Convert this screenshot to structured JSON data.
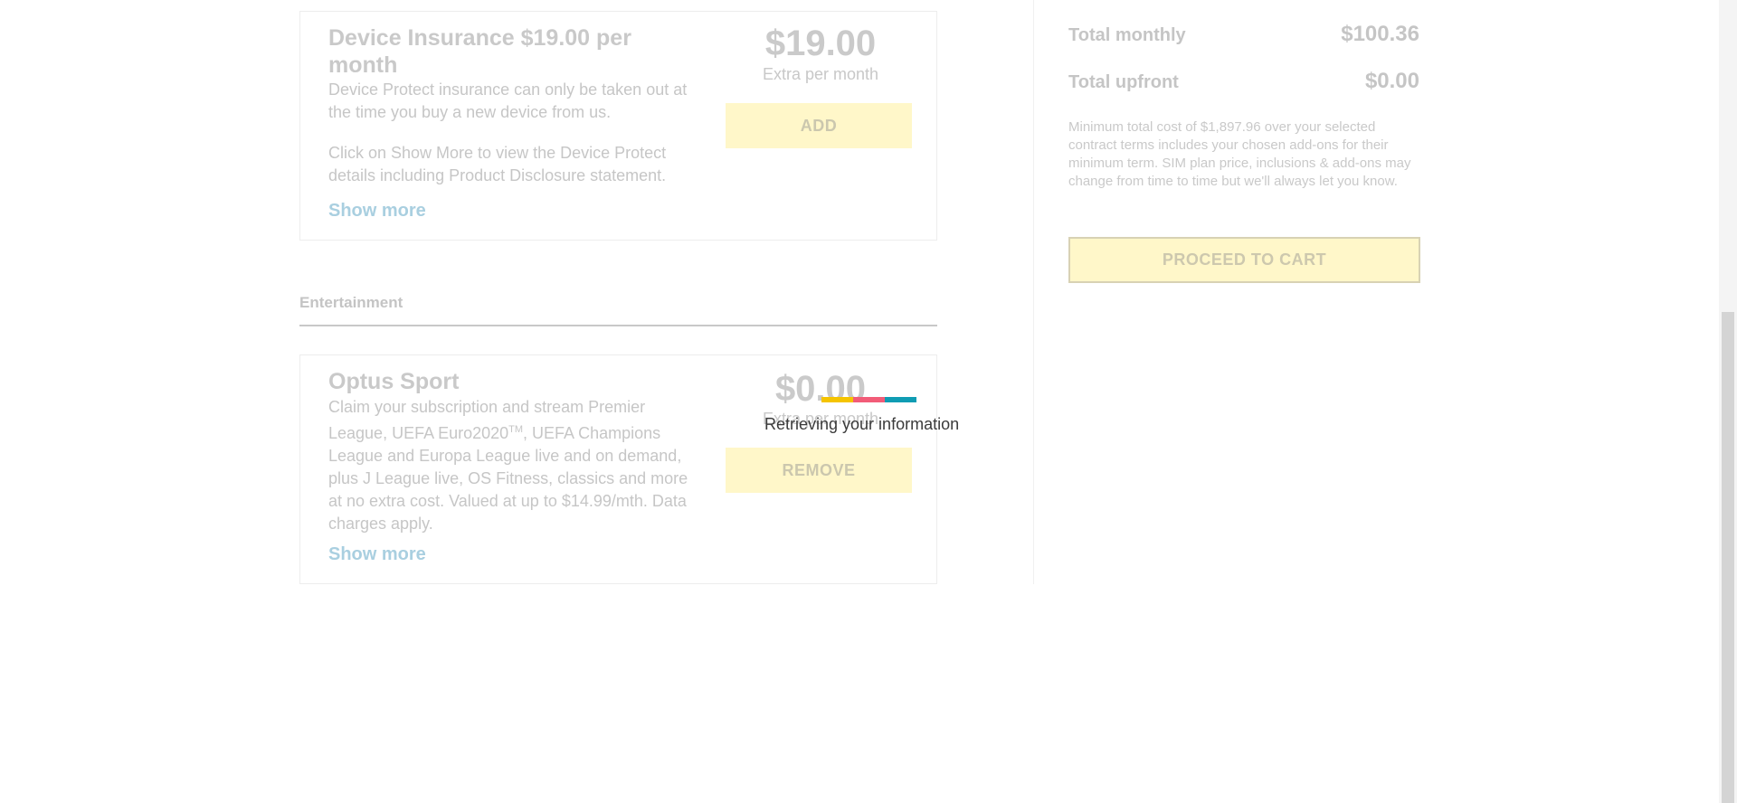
{
  "cards": {
    "device_insurance": {
      "title": "Device Insurance $19.00 per month",
      "desc1": "Device Protect insurance can only be taken out at the time you buy a new device from us.",
      "desc2": "Click on Show More to view the Device Protect details including Product Disclosure statement.",
      "show_more": "Show more",
      "price": "$19.00",
      "price_sub": "Extra per month",
      "button": "ADD"
    },
    "optus_sport": {
      "title": "Optus Sport",
      "desc_part1": "Claim your subscription and stream Premier League, UEFA Euro2020",
      "desc_sup": "TM",
      "desc_part2": ", UEFA Champions League and Europa League live and on demand, plus J League live, OS Fitness, classics and more at no extra cost. Valued at up to $14.99/mth. Data charges apply.",
      "show_more": "Show more",
      "price": "$0.00",
      "price_sub": "Extra per month",
      "button": "REMOVE"
    }
  },
  "section": {
    "entertainment": "Entertainment"
  },
  "summary": {
    "total_monthly_label": "Total monthly",
    "total_monthly_value": "$100.36",
    "total_upfront_label": "Total upfront",
    "total_upfront_value": "$0.00",
    "note": "Minimum total cost of $1,897.96 over your selected contract terms includes your chosen add-ons for their minimum term. SIM plan price, inclusions & add-ons may change from time to time but we'll always let you know.",
    "proceed_button": "PROCEED TO CART"
  },
  "loader": {
    "text": "Retrieving your information",
    "colors": [
      "#f5c400",
      "#f25c78",
      "#0f9cb3"
    ]
  }
}
